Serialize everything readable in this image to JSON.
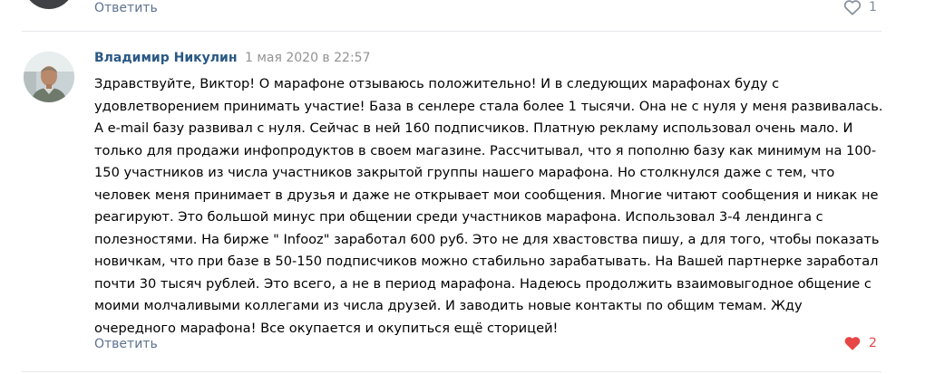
{
  "previous_comment": {
    "reply_label": "Ответить",
    "like_count": "1"
  },
  "comment": {
    "author": "Владимир Никулин",
    "date": "1 мая 2020 в 22:57",
    "text_lines": [
      "Здравствуйте, Виктор! О марафоне отзываюсь положительно! И в следующих марафонах буду с",
      "удовлетворением принимать участие! База в сенлере стала более 1 тысячи. Она не с нуля у меня развивалась.",
      "А e-mail базу развивал с нуля. Сейчас в ней 160 подписчиков. Платную рекламу использовал очень мало. И",
      "только для продажи инфопродуктов в своем магазине. Рассчитывал, что я пополню базу как минимум на 100-",
      "150 участников из числа участников закрытой группы нашего марафона. Но столкнулся даже с тем, что",
      "человек меня принимает в друзья и даже не открывает мои сообщения. Многие читают сообщения и никак не",
      "реагируют. Это большой минус при общении среди участников марафона. Использовал 3-4 лендинга с",
      "полезностями. На бирже \" Infooz\" заработал 600 руб. Это не для хвастовства пишу, а для того, чтобы показать",
      "новичкам, что при базе в 50-150 подписчиков можно стабильно зарабатывать. На Вашей партнерке заработал",
      "почти 30 тысяч рублей. Это всего, а не в период марафона. Надеюсь продолжить взаимовыгодное общение с",
      "моими молчаливыми коллегами из числа друзей. И заводить новые контакты по общим темам. Жду",
      "очередного марафона! Все окупается и окупиться ещё сторицей!"
    ],
    "reply_label": "Ответить",
    "like_count": "2",
    "liked": true
  },
  "colors": {
    "author": "#2a5885",
    "date": "#939393",
    "reply_link": "#5d7290",
    "like_inactive": "#818c99",
    "like_active": "#e64646",
    "separator": "#e7e8ec"
  },
  "icons": {
    "like_inactive": "heart-outline-icon",
    "like_active": "heart-filled-icon"
  }
}
